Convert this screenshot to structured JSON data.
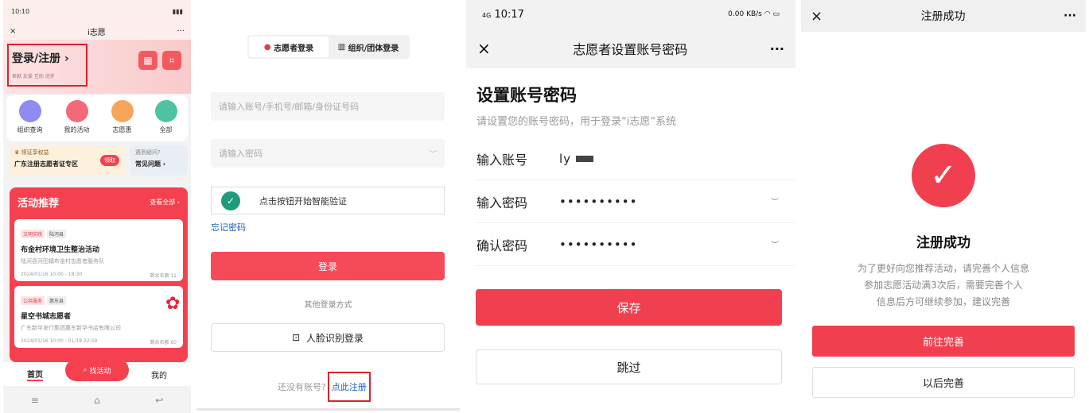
{
  "panel1": {
    "status_time": "10:10",
    "app_title": "i志愿",
    "close_icon": "×",
    "more_icon": "···",
    "login_title": "登录/注册",
    "login_sub": "奉献 友爱 互助 进步",
    "quick": [
      {
        "label": "组织查询",
        "color": "#8f8cf0"
      },
      {
        "label": "我的活动",
        "color": "#f26a78"
      },
      {
        "label": "志愿惠",
        "color": "#f7a55a"
      },
      {
        "label": "全部",
        "color": "#4fc3a1"
      }
    ],
    "promo1_line1": "领证享权益",
    "promo1_line2": "广东注册志愿者证专区",
    "promo1_btn": "领取",
    "promo2_line1": "遇到疑问?",
    "promo2_line2": "常见问题 ›",
    "activity_title": "活动推荐",
    "activity_more": "查看全部 ›",
    "activities": [
      {
        "tag1": "文明实践",
        "tag2": "陆河县",
        "name": "布金村环境卫生整治活动",
        "org": "陆河县河田镇布金村志愿者服务队",
        "time": "2024/01/16 10:00 - 18:30",
        "remain": "剩余名额 11"
      },
      {
        "tag1": "公共服务",
        "tag2": "惠东县",
        "name": "星空书城志愿者",
        "org": "广东新华发行集团惠东新华书店有限公司",
        "time": "2024/01/16 10:00 - 01/18 22:59",
        "remain": "剩余名额 60"
      }
    ],
    "nav_home": "首页",
    "nav_find": "找活动",
    "nav_mine": "我的"
  },
  "panel2": {
    "tab_volunteer": "志愿者登录",
    "tab_org": "组织/团体登录",
    "account_placeholder": "请输入账号/手机号/邮箱/身份证号码",
    "password_placeholder": "请输入密码",
    "verify_text": "点击按钮开始智能验证",
    "forgot": "忘记密码",
    "login_btn": "登录",
    "other_login": "其他登录方式",
    "face_login": "人脸识别登录",
    "no_account": "还没有账号?",
    "register_link": "点此注册"
  },
  "panel3": {
    "status_time": "10:17",
    "status_net": "4G",
    "status_speed": "0.00 KB/s",
    "title": "志愿者设置账号密码",
    "heading": "设置账号密码",
    "sub": "请设置您的账号密码，用于登录“i志愿”系统",
    "label_account": "输入账号",
    "value_account": "ly",
    "label_password": "输入密码",
    "value_password": "••••••••••",
    "label_confirm": "确认密码",
    "value_confirm": "••••••••••",
    "save_btn": "保存",
    "skip_btn": "跳过"
  },
  "panel4": {
    "title": "注册成功",
    "success_title": "注册成功",
    "desc1": "为了更好向您推荐活动，请完善个人信息",
    "desc2": "参加志愿活动满3次后，需要完善个人",
    "desc3": "信息后方可继续参加，建议完善",
    "btn_complete": "前往完善",
    "btn_later": "以后完善"
  }
}
